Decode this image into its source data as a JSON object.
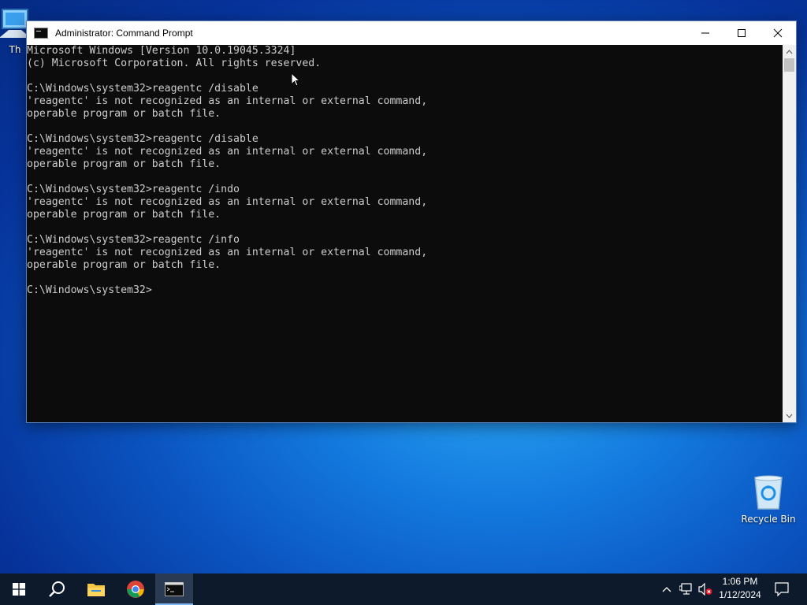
{
  "desktop": {
    "icons": [
      {
        "label": "Th"
      },
      {
        "label": "Recycle Bin"
      }
    ]
  },
  "window": {
    "title": "Administrator: Command Prompt",
    "controls": {
      "minimize": "minimize",
      "maximize": "maximize",
      "close": "close"
    },
    "console_lines": [
      "Microsoft Windows [Version 10.0.19045.3324]",
      "(c) Microsoft Corporation. All rights reserved.",
      "",
      "C:\\Windows\\system32>reagentc /disable",
      "'reagentc' is not recognized as an internal or external command,",
      "operable program or batch file.",
      "",
      "C:\\Windows\\system32>reagentc /disable",
      "'reagentc' is not recognized as an internal or external command,",
      "operable program or batch file.",
      "",
      "C:\\Windows\\system32>reagentc /indo",
      "'reagentc' is not recognized as an internal or external command,",
      "operable program or batch file.",
      "",
      "C:\\Windows\\system32>reagentc /info",
      "'reagentc' is not recognized as an internal or external command,",
      "operable program or batch file.",
      "",
      "C:\\Windows\\system32>"
    ],
    "colors": {
      "console_bg": "#0c0c0c",
      "console_fg": "#cccccc"
    }
  },
  "taskbar": {
    "pinned": [
      "windows-start-icon",
      "search-icon",
      "file-explorer-icon",
      "chrome-icon",
      "command-prompt-icon"
    ],
    "tray": [
      "chevron-up-icon",
      "network-icon",
      "volume-muted-icon",
      "notifications-icon"
    ],
    "clock": {
      "time": "1:06 PM",
      "date": "1/12/2024"
    }
  }
}
